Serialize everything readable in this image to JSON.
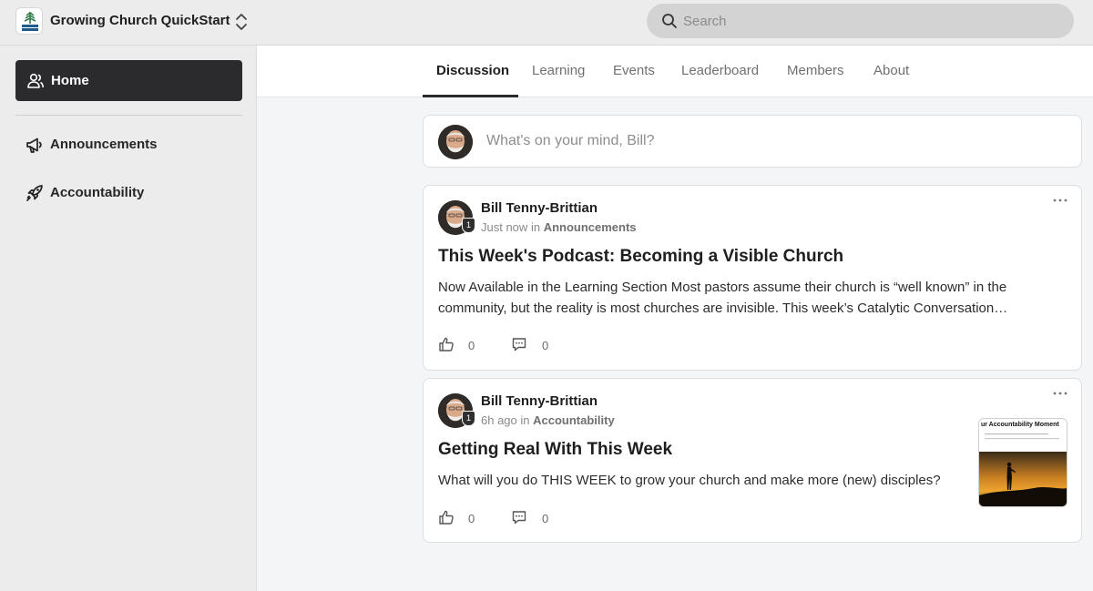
{
  "app": {
    "name": "Growing Church QuickStart",
    "logo_icon": "growing-church-logo"
  },
  "search": {
    "placeholder": "Search"
  },
  "sidebar": {
    "items": [
      {
        "label": "Home",
        "icon": "users-icon",
        "active": true
      },
      {
        "label": "Announcements",
        "icon": "megaphone-icon"
      },
      {
        "label": "Accountability",
        "icon": "rocket-icon"
      }
    ]
  },
  "tabs": [
    {
      "label": "Discussion",
      "active": true
    },
    {
      "label": "Learning"
    },
    {
      "label": "Events"
    },
    {
      "label": "Leaderboard"
    },
    {
      "label": "Members"
    },
    {
      "label": "About"
    }
  ],
  "composer": {
    "placeholder": "What's on your mind, Bill?"
  },
  "posts": [
    {
      "author": "Bill Tenny-Brittian",
      "level": "1",
      "time": "Just now",
      "in_word": "in",
      "category": "Announcements",
      "title": "This Week's Podcast: Becoming a Visible Church",
      "body": "Now Available in the Learning Section Most pastors assume their church is “well known” in the community, but the reality is most churches are invisible. This week’s Catalytic Conversation…",
      "likes": "0",
      "comments": "0"
    },
    {
      "author": "Bill Tenny-Brittian",
      "level": "1",
      "time": "6h ago",
      "in_word": "in",
      "category": "Accountability",
      "title": "Getting Real With This Week",
      "body": "What will you do THIS WEEK to grow your church and make more (new) disciples?",
      "likes": "0",
      "comments": "0",
      "thumbnail": {
        "heading": "ur Accountability Moment"
      }
    }
  ],
  "colors": {
    "active_nav": "#2b2b2d",
    "search_bg": "#d3d3d3",
    "page_bg": "#f4f5f7"
  }
}
